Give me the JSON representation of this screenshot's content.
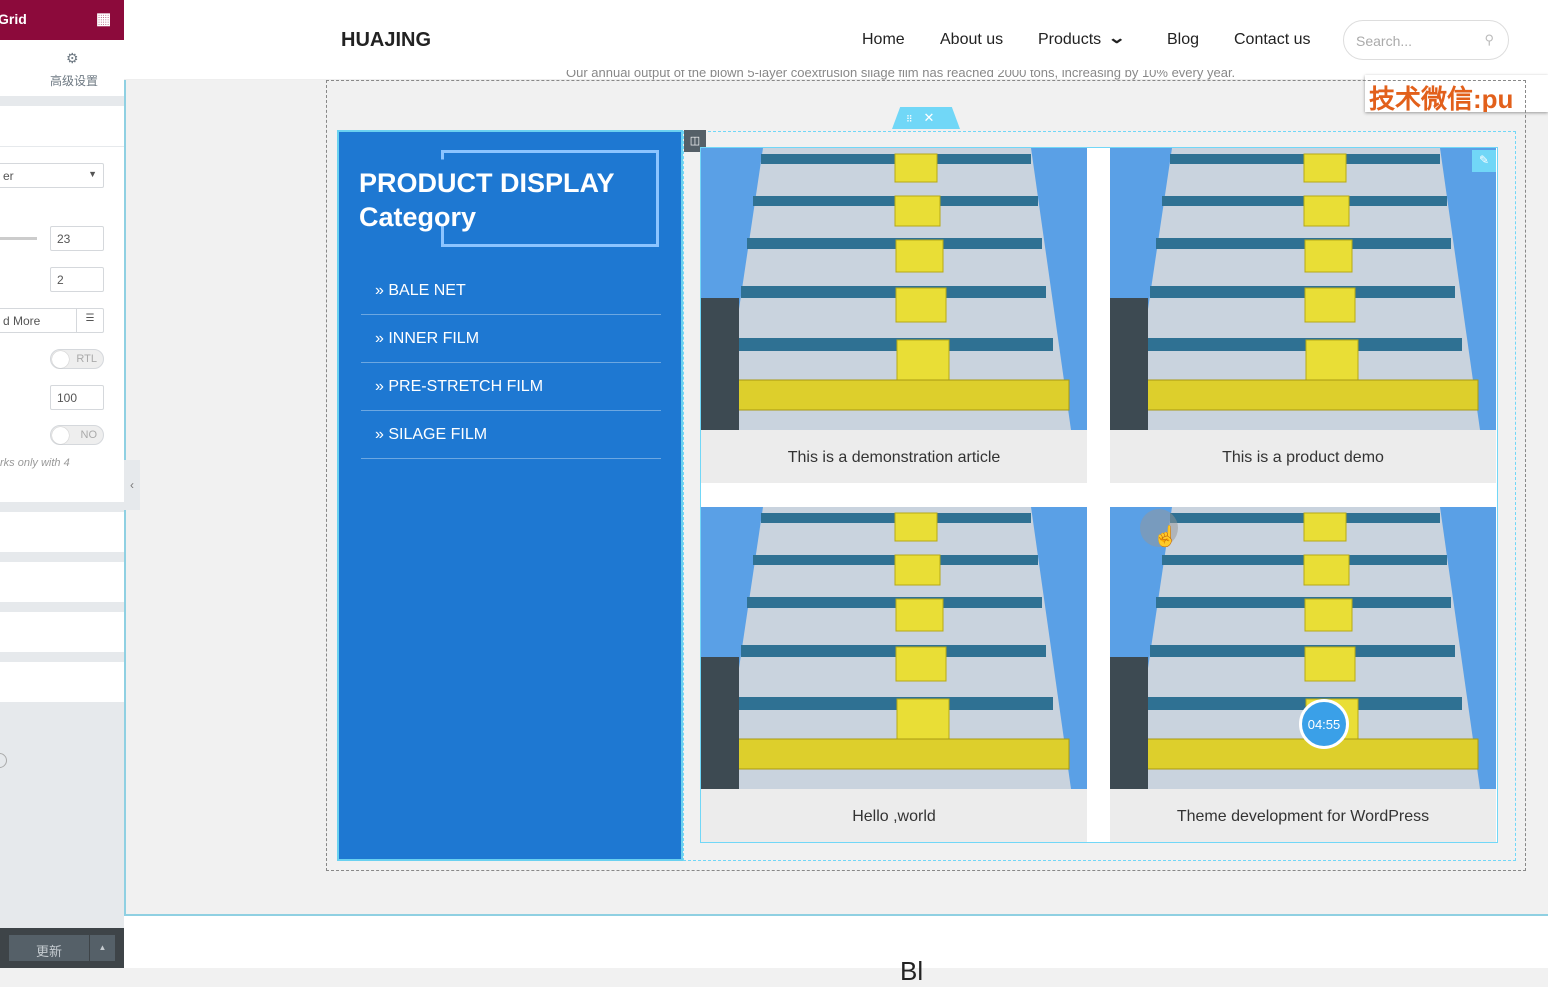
{
  "editor_panel": {
    "title": "Grid",
    "advanced_tab": "高级设置",
    "select_value": "er",
    "slider_value": "23",
    "columns_value": "2",
    "read_more_value": "d More",
    "rtl_label": "RTL",
    "number_value": "100",
    "toggle_label": "NO",
    "note": "rks only with 4",
    "update_button": "更新"
  },
  "header": {
    "logo": "HUAJING",
    "nav": [
      "Home",
      "About us",
      "Products",
      "Blog",
      "Contact us"
    ],
    "search_placeholder": "Search..."
  },
  "intro_text": "Our annual output of the blown 5-layer coextrusion silage film has reached 2000 tons, increasing by 10% every year.",
  "watermark": "技术微信:pu",
  "sidebar": {
    "title_line1": "PRODUCT DISPLAY",
    "title_line2": "Category",
    "categories": [
      "BALE NET",
      "INNER FILM",
      "PRE-STRETCH FILM",
      "SILAGE FILM"
    ]
  },
  "posts": [
    {
      "title": "This is a demonstration article"
    },
    {
      "title": "This is a product demo"
    },
    {
      "title": "Hello ,world"
    },
    {
      "title": "Theme development for WordPress"
    }
  ],
  "video_badge": "04:55",
  "next_section_heading": "Bl",
  "colors": {
    "panel_header": "#8c0a3b",
    "category_bg": "#1e78d2",
    "editor_accent": "#71d7f7"
  }
}
